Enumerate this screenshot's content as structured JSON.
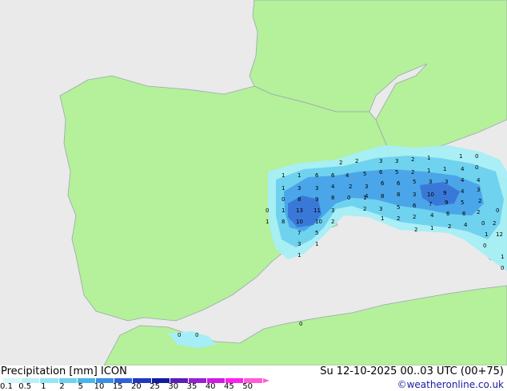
{
  "header": {
    "title": "Precipitation [mm]  ICON",
    "datetime": "Su 12-10-2025 00..03 UTC (00+75)",
    "credit": "©weatheronline.co.uk"
  },
  "colors": {
    "sea": "#eaeaea",
    "land": "#b5f09a",
    "border": "#9aa6b0",
    "precip_light": "#a6eef7",
    "precip_medium": "#6fd2ef",
    "precip_heavy": "#4aa6e8",
    "precip_very_heavy": "#3a78d8"
  },
  "legend": {
    "labels": [
      "0.1",
      "0.5",
      "1",
      "2",
      "5",
      "10",
      "15",
      "20",
      "25",
      "30",
      "35",
      "40",
      "45",
      "50"
    ],
    "colors": [
      "#d4f8fb",
      "#b6f0f8",
      "#94e6f6",
      "#6fd2ef",
      "#4ab6ea",
      "#3a8fe0",
      "#2f62d6",
      "#2038bf",
      "#0f1d9e",
      "#5a1fb8",
      "#9a1fd0",
      "#d21ae0",
      "#ff1ff0",
      "#ff5ad8"
    ]
  },
  "map_labels": [
    "1",
    "1",
    "6",
    "6",
    "4",
    "5",
    "6",
    "5",
    "2",
    "1",
    "1",
    "0",
    "1",
    "3",
    "3",
    "4",
    "2",
    "3",
    "6",
    "6",
    "5",
    "3",
    "4",
    "4",
    "0",
    "8",
    "9",
    "8",
    "0",
    "1",
    "8",
    "8",
    "10",
    "9",
    "4",
    "3",
    "0",
    "1",
    "13",
    "11",
    "3",
    "5",
    "6",
    "7",
    "9",
    "5",
    "2",
    "1",
    "8",
    "10",
    "10",
    "2",
    "1",
    "2",
    "2",
    "4",
    "6",
    "6",
    "0",
    "7",
    "5",
    "2",
    "1",
    "2",
    "4",
    "0",
    "12",
    "3",
    "1",
    "0",
    "1",
    "1",
    "0",
    "0",
    "0",
    "0",
    "2",
    "2",
    "3",
    "3",
    "2",
    "1",
    "1",
    "2",
    "3",
    "2",
    "1",
    "2",
    "0",
    "4",
    "3",
    "3",
    "4"
  ]
}
